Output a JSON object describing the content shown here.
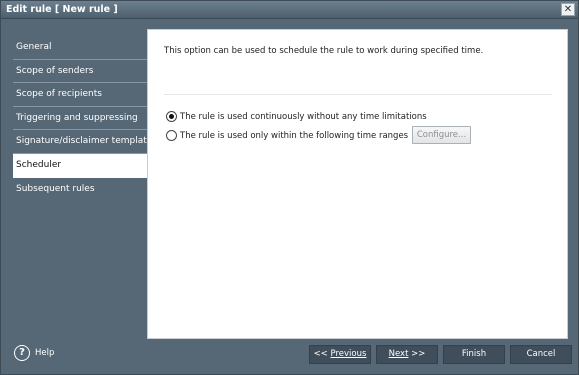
{
  "window": {
    "title": "Edit rule [ New rule ]",
    "close_glyph": "✕"
  },
  "sidebar": {
    "items": [
      {
        "label": "General"
      },
      {
        "label": "Scope of senders"
      },
      {
        "label": "Scope of recipients"
      },
      {
        "label": "Triggering and suppressing"
      },
      {
        "label": "Signature/disclaimer template"
      },
      {
        "label": "Scheduler",
        "active": true
      },
      {
        "label": "Subsequent rules"
      }
    ]
  },
  "main": {
    "description": "This option can be used to schedule the rule to work during specified time.",
    "options": [
      {
        "label": "The rule is used continuously without any time limitations",
        "selected": true
      },
      {
        "label": "The rule is used only within the following time ranges",
        "selected": false
      }
    ],
    "configure_label": "Configure..."
  },
  "footer": {
    "help_glyph": "?",
    "help_label": "Help",
    "prev_arrows": "<<",
    "prev_label": "Previous",
    "next_label": "Next",
    "next_arrows": ">>",
    "finish_label": "Finish",
    "cancel_label": "Cancel"
  },
  "colors": {
    "window_bg": "#566876",
    "button_bg": "#3f4e5a",
    "content_bg": "#ffffff"
  },
  "icons": {
    "close": "close-icon",
    "help": "help-icon",
    "radio": "radio-icon"
  }
}
